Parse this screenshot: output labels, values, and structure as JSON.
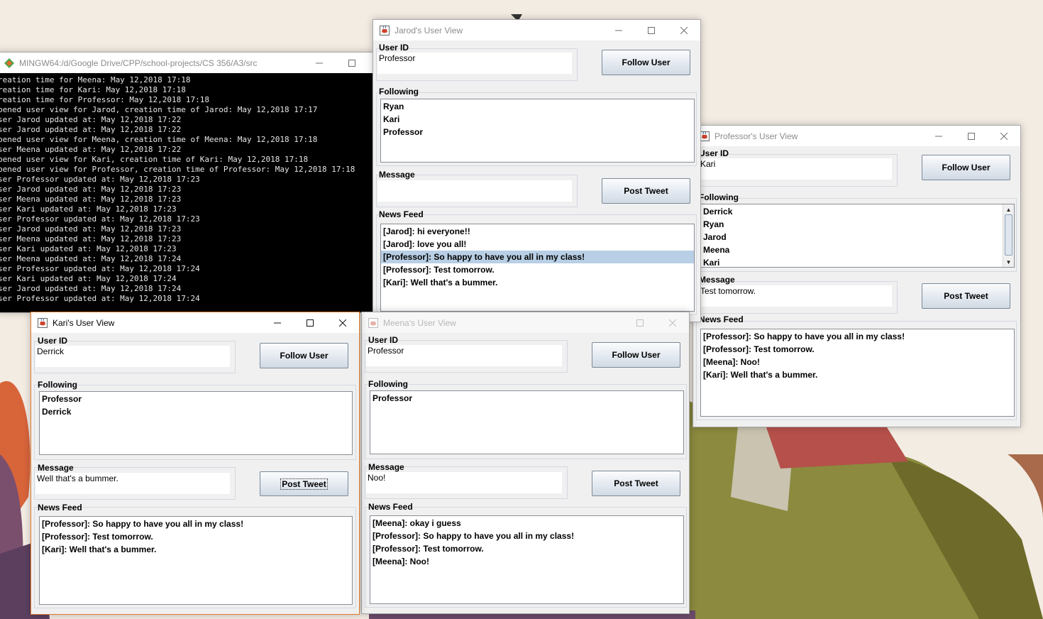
{
  "console": {
    "title": "MINGW64:/d/Google Drive/CPP/school-projects/CS 356/A3/src",
    "lines": [
      "reation time for Meena: May 12,2018 17:18",
      "reation time for Kari: May 12,2018 17:18",
      "reation time for Professor: May 12,2018 17:18",
      "pened user view for Jarod, creation time of Jarod: May 12,2018 17:17",
      "ser Jarod updated at: May 12,2018 17:22",
      "ser Jarod updated at: May 12,2018 17:22",
      "pened user view for Meena, creation time of Meena: May 12,2018 17:18",
      "ser Meena updated at: May 12,2018 17:22",
      "pened user view for Kari, creation time of Kari: May 12,2018 17:18",
      "pened user view for Professor, creation time of Professor: May 12,2018 17:18",
      "ser Professor updated at: May 12,2018 17:23",
      "ser Jarod updated at: May 12,2018 17:23",
      "ser Meena updated at: May 12,2018 17:23",
      "ser Kari updated at: May 12,2018 17:23",
      "ser Professor updated at: May 12,2018 17:23",
      "ser Jarod updated at: May 12,2018 17:23",
      "ser Meena updated at: May 12,2018 17:23",
      "ser Kari updated at: May 12,2018 17:23",
      "ser Meena updated at: May 12,2018 17:24",
      "ser Professor updated at: May 12,2018 17:24",
      "ser Kari updated at: May 12,2018 17:24",
      "ser Jarod updated at: May 12,2018 17:24",
      "ser Professor updated at: May 12,2018 17:24"
    ]
  },
  "labels": {
    "user_id": "User ID",
    "following": "Following",
    "message": "Message",
    "news_feed": "News Feed",
    "follow_user": "Follow User",
    "post_tweet": "Post Tweet"
  },
  "windows": {
    "jarod": {
      "title": "Jarod's User View",
      "user_id_value": "Professor",
      "following": [
        "Ryan",
        "Kari",
        "Professor"
      ],
      "message_value": "",
      "news_feed": [
        "[Jarod]: hi everyone!!",
        "[Jarod]: love you all!",
        "[Professor]: So happy to have you all in my class!",
        "[Professor]: Test tomorrow.",
        "[Kari]: Well that's a bummer."
      ],
      "selected_feed_item": "[Professor]: So happy to have you all in my class!"
    },
    "professor": {
      "title": "Professor's User View",
      "user_id_value": "Kari",
      "following": [
        "Derrick",
        "Ryan",
        "Jarod",
        "Meena",
        "Kari"
      ],
      "message_value": "Test tomorrow.",
      "news_feed": [
        "[Professor]: So happy to have you all in my class!",
        "[Professor]: Test tomorrow.",
        "[Meena]: Noo!",
        "[Kari]: Well that's a bummer."
      ]
    },
    "kari": {
      "title": "Kari's User View",
      "user_id_value": "Derrick",
      "following": [
        "Professor",
        "Derrick"
      ],
      "message_value": "Well that's a bummer.",
      "news_feed": [
        "[Professor]: So happy to have you all in my class!",
        "[Professor]: Test tomorrow.",
        "[Kari]: Well that's a bummer."
      ]
    },
    "meena": {
      "title": "Meena's User View",
      "user_id_value": "Professor",
      "following": [
        "Professor"
      ],
      "message_value": "Noo!",
      "news_feed": [
        "[Meena]: okay i guess",
        "[Professor]: So happy to have you all in my class!",
        "[Professor]: Test tomorrow.",
        "[Meena]: Noo!"
      ]
    }
  },
  "colors": {
    "active_window_border": "#e07b2e",
    "selection_highlight": "#b8cfe5",
    "console_background": "#000000"
  },
  "icons": {
    "java_app": "java-cup-icon",
    "console": "git-bash-icon",
    "minimize": "minimize-icon",
    "maximize": "maximize-icon",
    "close": "close-icon"
  }
}
